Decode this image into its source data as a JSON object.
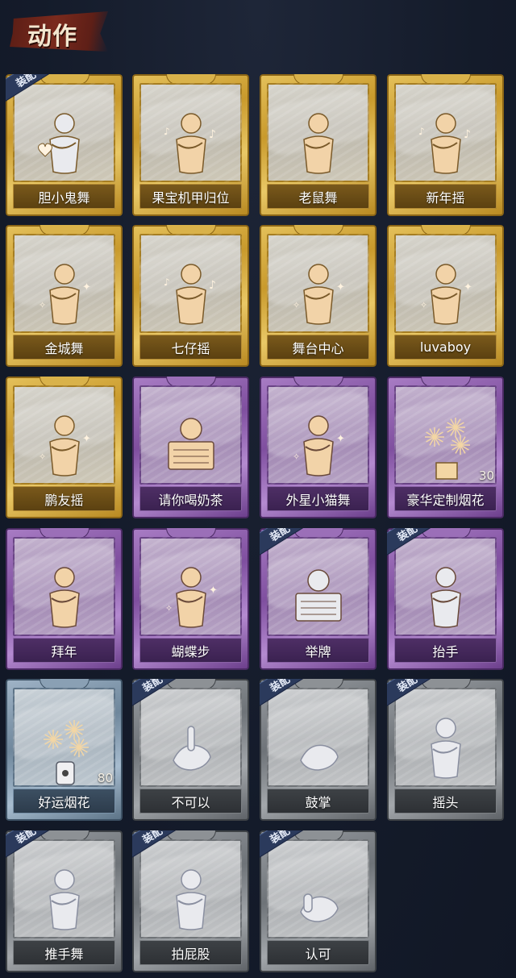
{
  "header": {
    "title": "动作"
  },
  "badge_label": "装配",
  "colors": {
    "gold": "#c99a2c",
    "purple": "#7f4f9f",
    "blue": "#6f879c",
    "grey": "#6e7378",
    "figure_gold": "#f2d3a8",
    "figure_white": "#e9eaee",
    "badge": "#2b3a5c"
  },
  "items": [
    {
      "label": "胆小鬼舞",
      "tier": "gold",
      "equipped": true,
      "icon": "dance-heart-icon"
    },
    {
      "label": "果宝机甲归位",
      "tier": "gold",
      "equipped": false,
      "icon": "dance-music-icon"
    },
    {
      "label": "老鼠舞",
      "tier": "gold",
      "equipped": false,
      "icon": "dance-icon"
    },
    {
      "label": "新年摇",
      "tier": "gold",
      "equipped": false,
      "icon": "dance-music-icon"
    },
    {
      "label": "金城舞",
      "tier": "gold",
      "equipped": false,
      "icon": "dance-sparkle-icon"
    },
    {
      "label": "七仔摇",
      "tier": "gold",
      "equipped": false,
      "icon": "dance-music-icon"
    },
    {
      "label": "舞台中心",
      "tier": "gold",
      "equipped": false,
      "icon": "dance-sparkle-icon"
    },
    {
      "label": "luvaboy",
      "tier": "gold",
      "equipped": false,
      "icon": "dance-sparkle-icon"
    },
    {
      "label": "鹏友摇",
      "tier": "gold",
      "equipped": false,
      "icon": "dance-sparkle-icon"
    },
    {
      "label": "请你喝奶茶",
      "tier": "purple",
      "equipped": false,
      "icon": "milk-tea-sign-icon"
    },
    {
      "label": "外星小猫舞",
      "tier": "purple",
      "equipped": false,
      "icon": "dance-sparkle-icon"
    },
    {
      "label": "豪华定制烟花",
      "tier": "purple",
      "equipped": false,
      "icon": "fireworks-box-icon",
      "count": "30"
    },
    {
      "label": "拜年",
      "tier": "purple",
      "equipped": false,
      "icon": "greeting-icon"
    },
    {
      "label": "蝴蝶步",
      "tier": "purple",
      "equipped": false,
      "icon": "dance-point-icon"
    },
    {
      "label": "举牌",
      "tier": "purple",
      "equipped": true,
      "icon": "hold-sign-icon"
    },
    {
      "label": "抬手",
      "tier": "purple",
      "equipped": true,
      "icon": "raise-hand-icon"
    },
    {
      "label": "好运烟花",
      "tier": "blue",
      "equipped": false,
      "icon": "firework-can-icon",
      "count": "80"
    },
    {
      "label": "不可以",
      "tier": "grey",
      "equipped": true,
      "icon": "finger-wag-icon"
    },
    {
      "label": "鼓掌",
      "tier": "grey",
      "equipped": true,
      "icon": "clap-icon"
    },
    {
      "label": "摇头",
      "tier": "grey",
      "equipped": true,
      "icon": "head-shake-icon"
    },
    {
      "label": "推手舞",
      "tier": "grey",
      "equipped": true,
      "icon": "push-dance-icon"
    },
    {
      "label": "拍屁股",
      "tier": "grey",
      "equipped": true,
      "icon": "pat-butt-icon"
    },
    {
      "label": "认可",
      "tier": "grey",
      "equipped": true,
      "icon": "thumbs-up-icon"
    }
  ]
}
